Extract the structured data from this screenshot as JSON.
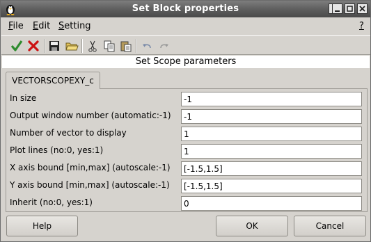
{
  "window": {
    "title": "Set Block properties",
    "help_button": "?",
    "minimize_symbol": "_",
    "close_symbol": "✕"
  },
  "menubar": {
    "file": {
      "accel": "F",
      "rest": "ile"
    },
    "edit": {
      "accel": "E",
      "rest": "dit"
    },
    "setting": {
      "accel": "S",
      "rest": "etting"
    },
    "help": "?"
  },
  "toolbar": {
    "icons": [
      "check-icon",
      "cross-icon",
      "save-icon",
      "open-icon",
      "cut-icon",
      "copy-icon",
      "paste-icon",
      "undo-icon",
      "redo-icon"
    ],
    "colors": {
      "check": "#2e8b2e",
      "cross": "#cc1111"
    }
  },
  "section_label": "Set Scope parameters",
  "tab": {
    "label": "VECTORSCOPEXY_c"
  },
  "fields": [
    {
      "label": "In size",
      "value": "-1"
    },
    {
      "label": "Output window number (automatic:-1)",
      "value": "-1"
    },
    {
      "label": "Number of vector to display",
      "value": "1"
    },
    {
      "label": "Plot lines (no:0, yes:1)",
      "value": "1"
    },
    {
      "label": "X axis bound [min,max] (autoscale:-1)",
      "value": "[-1.5,1.5]"
    },
    {
      "label": "Y axis bound [min,max] (autoscale:-1)",
      "value": "[-1.5,1.5]"
    },
    {
      "label": "Inherit (no:0, yes:1)",
      "value": "0"
    }
  ],
  "buttons": {
    "help": "Help",
    "ok": "OK",
    "cancel": "Cancel"
  }
}
